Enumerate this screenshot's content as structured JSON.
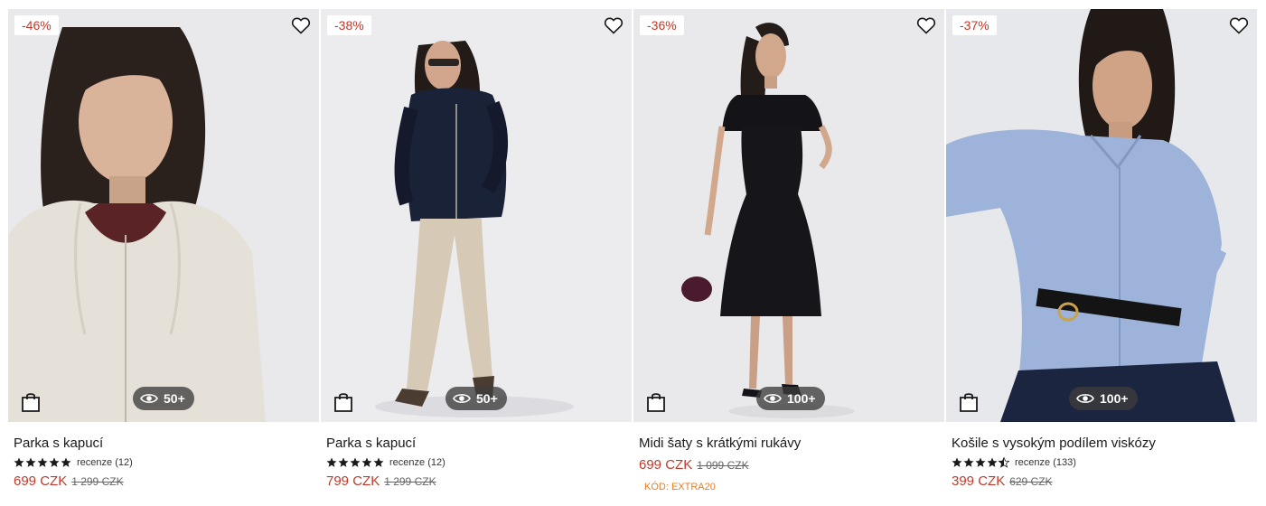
{
  "colors": {
    "price": "#c0392b",
    "badge_text": "#c0392b",
    "promo": "#e67e22",
    "views_bg": "#3c3c3c"
  },
  "products": [
    {
      "discount": "-46%",
      "views": "50+",
      "name": "Parka s kapucí",
      "rating": 5,
      "reviews": "recenze (12)",
      "price": "699 CZK",
      "old_price": "1 299 CZK",
      "image": "woman-in-cream-parka",
      "icons": [
        "heart-icon",
        "shopping-bag-icon",
        "eye-icon"
      ]
    },
    {
      "discount": "-38%",
      "views": "50+",
      "name": "Parka s kapucí",
      "rating": 5,
      "reviews": "recenze (12)",
      "price": "799 CZK",
      "old_price": "1 299 CZK",
      "image": "woman-in-navy-jacket",
      "icons": [
        "heart-icon",
        "shopping-bag-icon",
        "eye-icon"
      ]
    },
    {
      "discount": "-36%",
      "views": "100+",
      "name": "Midi šaty s krátkými rukávy",
      "price": "699 CZK",
      "old_price": "1 099 CZK",
      "promo": "KÓD: EXTRA20",
      "image": "woman-in-black-midi-dress",
      "icons": [
        "heart-icon",
        "shopping-bag-icon",
        "eye-icon"
      ]
    },
    {
      "discount": "-37%",
      "views": "100+",
      "name": "Košile s vysokým podílem viskózy",
      "rating": 4.5,
      "reviews": "recenze (133)",
      "price": "399 CZK",
      "old_price": "629 CZK",
      "image": "woman-in-blue-shirt",
      "icons": [
        "heart-icon",
        "shopping-bag-icon",
        "eye-icon"
      ]
    }
  ]
}
